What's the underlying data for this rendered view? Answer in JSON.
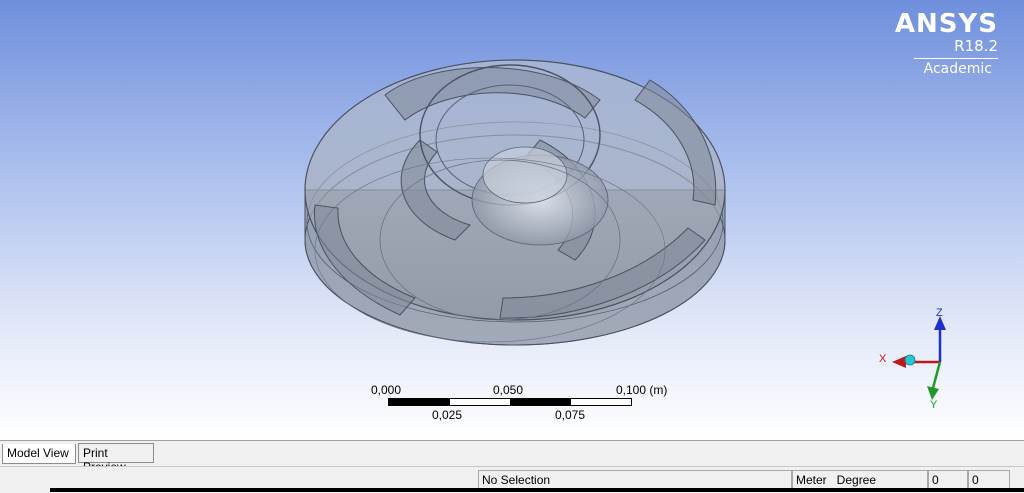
{
  "logo": {
    "name": "ANSYS",
    "version": "R18.2",
    "edition": "Academic"
  },
  "scale": {
    "top_labels": [
      "0,000",
      "0,050",
      "0,100 (m)"
    ],
    "bottom_labels": [
      "0,025",
      "0,075"
    ]
  },
  "triad": {
    "x": "X",
    "y": "Y",
    "z": "Z"
  },
  "tabs": [
    {
      "label": "Model View",
      "active": true
    },
    {
      "label": "Print Preview",
      "active": false
    }
  ],
  "status": {
    "selection": "No Selection",
    "units": "Meter   Degree",
    "value_1": "0",
    "value_2": "0"
  },
  "colors": {
    "sky_top": "#6f8fdc",
    "sky_bottom": "#ffffff",
    "model": "#9ca4b0",
    "axis_x": "#c01818",
    "axis_y": "#1f9a2a",
    "axis_z": "#1f2fc8",
    "origin": "#26c6d6"
  }
}
